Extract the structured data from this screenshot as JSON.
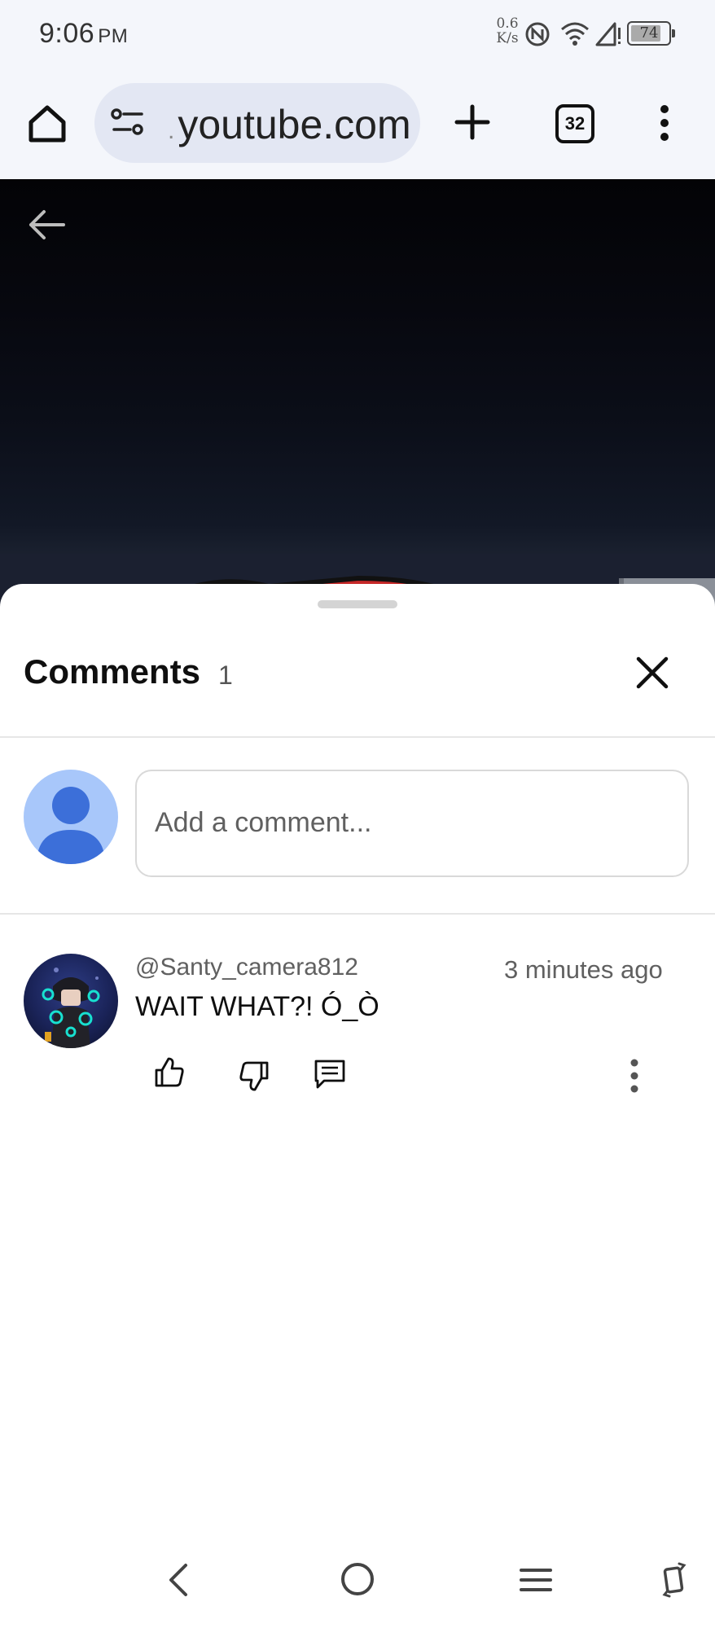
{
  "status_bar": {
    "time": "9:06",
    "ampm": "PM",
    "net_speed_value": "0.6",
    "net_speed_unit": "K/s",
    "battery": "74"
  },
  "browser": {
    "url": "youtube.com",
    "tab_count": "32"
  },
  "comments": {
    "title": "Comments",
    "count": "1",
    "add_placeholder": "Add a comment...",
    "items": [
      {
        "author": "@Santy_camera812",
        "time": "3 minutes ago",
        "text": "WAIT WHAT?! Ó_Ò"
      }
    ]
  },
  "colors": {
    "browser_bg": "#f4f6fb",
    "url_pill": "#e3e7f3",
    "avatar_default": "#a8c7fa",
    "avatar_accent": "#3c6fd9"
  }
}
